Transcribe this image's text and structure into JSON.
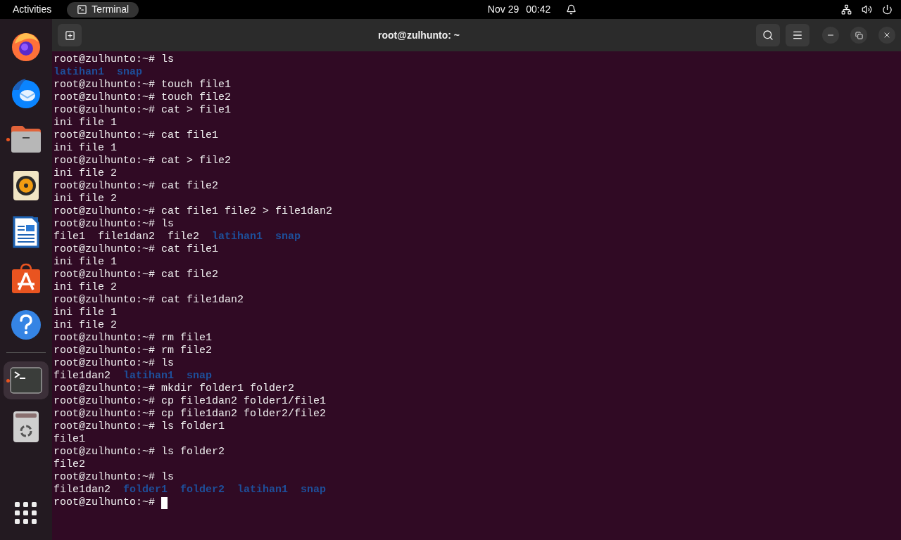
{
  "top_bar": {
    "activities": "Activities",
    "app": "Terminal",
    "date": "Nov 29",
    "time": "00:42"
  },
  "dock": {
    "apps": [
      {
        "kind": "browser",
        "running": false,
        "selected": false
      },
      {
        "kind": "mail",
        "running": false,
        "selected": false
      },
      {
        "kind": "files",
        "running": true,
        "selected": false
      },
      {
        "kind": "music",
        "running": false,
        "selected": false
      },
      {
        "kind": "writer",
        "running": false,
        "selected": false
      },
      {
        "kind": "store",
        "running": false,
        "selected": false
      },
      {
        "kind": "help",
        "running": false,
        "selected": false
      },
      {
        "kind": "separator"
      },
      {
        "kind": "terminal",
        "running": true,
        "selected": true
      },
      {
        "kind": "trash",
        "running": false,
        "selected": false
      }
    ]
  },
  "window": {
    "title": "root@zulhunto: ~"
  },
  "terminal": {
    "lines": [
      {
        "kind": "prompt",
        "prompt": "root@zulhunto:~#",
        "command": "ls"
      },
      {
        "kind": "listing",
        "items": [
          {
            "text": "latihan1",
            "dir": true
          },
          {
            "text": "snap",
            "dir": true
          }
        ]
      },
      {
        "kind": "prompt",
        "prompt": "root@zulhunto:~#",
        "command": "touch file1"
      },
      {
        "kind": "prompt",
        "prompt": "root@zulhunto:~#",
        "command": "touch file2"
      },
      {
        "kind": "prompt",
        "prompt": "root@zulhunto:~#",
        "command": "cat > file1"
      },
      {
        "kind": "output",
        "text": "ini file 1"
      },
      {
        "kind": "prompt",
        "prompt": "root@zulhunto:~#",
        "command": "cat file1"
      },
      {
        "kind": "output",
        "text": "ini file 1"
      },
      {
        "kind": "prompt",
        "prompt": "root@zulhunto:~#",
        "command": "cat > file2"
      },
      {
        "kind": "output",
        "text": "ini file 2"
      },
      {
        "kind": "prompt",
        "prompt": "root@zulhunto:~#",
        "command": "cat file2"
      },
      {
        "kind": "output",
        "text": "ini file 2"
      },
      {
        "kind": "prompt",
        "prompt": "root@zulhunto:~#",
        "command": "cat file1 file2 > file1dan2"
      },
      {
        "kind": "prompt",
        "prompt": "root@zulhunto:~#",
        "command": "ls"
      },
      {
        "kind": "listing",
        "items": [
          {
            "text": "file1",
            "dir": false
          },
          {
            "text": "file1dan2",
            "dir": false
          },
          {
            "text": "file2",
            "dir": false
          },
          {
            "text": "latihan1",
            "dir": true
          },
          {
            "text": "snap",
            "dir": true
          }
        ]
      },
      {
        "kind": "prompt",
        "prompt": "root@zulhunto:~#",
        "command": "cat file1"
      },
      {
        "kind": "output",
        "text": "ini file 1"
      },
      {
        "kind": "prompt",
        "prompt": "root@zulhunto:~#",
        "command": "cat file2"
      },
      {
        "kind": "output",
        "text": "ini file 2"
      },
      {
        "kind": "prompt",
        "prompt": "root@zulhunto:~#",
        "command": "cat file1dan2"
      },
      {
        "kind": "output",
        "text": "ini file 1"
      },
      {
        "kind": "output",
        "text": "ini file 2"
      },
      {
        "kind": "prompt",
        "prompt": "root@zulhunto:~#",
        "command": "rm file1"
      },
      {
        "kind": "prompt",
        "prompt": "root@zulhunto:~#",
        "command": "rm file2"
      },
      {
        "kind": "prompt",
        "prompt": "root@zulhunto:~#",
        "command": "ls"
      },
      {
        "kind": "listing",
        "items": [
          {
            "text": "file1dan2",
            "dir": false
          },
          {
            "text": "latihan1",
            "dir": true
          },
          {
            "text": "snap",
            "dir": true
          }
        ]
      },
      {
        "kind": "prompt",
        "prompt": "root@zulhunto:~#",
        "command": "mkdir folder1 folder2"
      },
      {
        "kind": "prompt",
        "prompt": "root@zulhunto:~#",
        "command": "cp file1dan2 folder1/file1"
      },
      {
        "kind": "prompt",
        "prompt": "root@zulhunto:~#",
        "command": "cp file1dan2 folder2/file2"
      },
      {
        "kind": "prompt",
        "prompt": "root@zulhunto:~#",
        "command": "ls folder1"
      },
      {
        "kind": "output",
        "text": "file1"
      },
      {
        "kind": "prompt",
        "prompt": "root@zulhunto:~#",
        "command": "ls folder2"
      },
      {
        "kind": "output",
        "text": "file2"
      },
      {
        "kind": "prompt",
        "prompt": "root@zulhunto:~#",
        "command": "ls"
      },
      {
        "kind": "listing",
        "items": [
          {
            "text": "file1dan2",
            "dir": false
          },
          {
            "text": "folder1",
            "dir": true
          },
          {
            "text": "folder2",
            "dir": true
          },
          {
            "text": "latihan1",
            "dir": true
          },
          {
            "text": "snap",
            "dir": true
          }
        ]
      },
      {
        "kind": "prompt",
        "prompt": "root@zulhunto:~#",
        "cursor": true
      }
    ]
  }
}
